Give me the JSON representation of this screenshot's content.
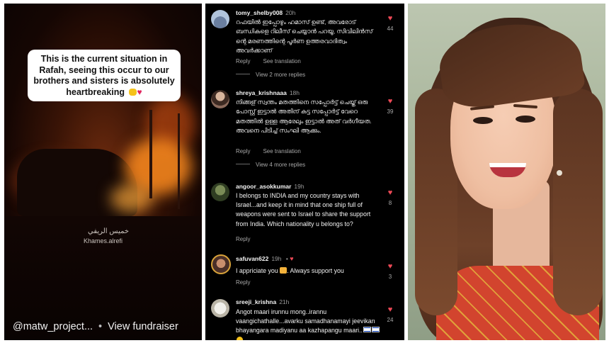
{
  "left_panel": {
    "caption": "This is the current situation in Rafah, seeing this occur to our brothers and sisters is absolutely heartbreaking",
    "watermark_arabic": "خميس الريفي",
    "watermark_handle": "Khames.alrefi",
    "account_handle": "@matw_project...",
    "separator": "•",
    "fundraiser_label": "View fundraiser"
  },
  "comments": [
    {
      "username": "tomy_shelby008",
      "time": "20h",
      "text": "റഫയിൽ ഇപ്പോഴും ഹമാസ് ഉണ്ട്, അവരോട് ബന്ധികളെ റിലീസ് ചെയ്യാൻ പറയൂ, സിവിലിൻസ് ന്റെ മരണത്തിന്റെ പൂർണ ഉത്തരവാദിത്വം അവർക്കാണ്",
      "likes": "44",
      "reply": "Reply",
      "see_translation": "See translation",
      "more_replies": "View 2 more replies"
    },
    {
      "username": "shreya_krishnaaa",
      "time": "18h",
      "text": "നിങ്ങള് സ്വന്തം മതത്തിനെ സപ്പോർട്ട് ചെയ്ത് ഒരു പോസ്റ്റ് ഇട്ടാൽ അതിന് കട്ട സപ്പോർട്ട് വേറെ മതത്തിൽ ഉള്ള ആരേലും ഇട്ടാൽ അത് വർഗീയത. അവനെ പിടിച്ച് സംഘി ആക്കും.",
      "likes": "39",
      "reply": "Reply",
      "see_translation": "See translation",
      "more_replies": "View 4 more replies"
    },
    {
      "username": "angoor_asokkumar",
      "time": "19h",
      "text": "I belongs to INDIA and my country stays with Israel...and keep it in mind that one ship full of weapons were sent to Israel to share the support from India. Which nationality u belongs to?",
      "likes": "8",
      "reply": "Reply"
    },
    {
      "username": "safuvan622",
      "time": "19h",
      "dot": "•",
      "text_before": "I appriciate you",
      "text_after": ". Always support you",
      "likes": "3",
      "reply": "Reply"
    },
    {
      "username": "sreeji_krishna",
      "time": "21h",
      "text": "Angot maari irunnu mong..irannu vaangichathalle...avarku samadhanamayi jeevikan bhayangara madiyanu aa kazhapangu maari..",
      "likes": "24"
    }
  ],
  "colors": {
    "heart": "#ed4956",
    "comments_bg": "#000000",
    "caption_bg": "#ffffff"
  },
  "icons": [
    "heart-icon",
    "avatar",
    "folded-hands-emoji",
    "broken-heart-emoji",
    "thumbs-up-emoji",
    "israel-flag-emoji",
    "smiley-emoji"
  ]
}
